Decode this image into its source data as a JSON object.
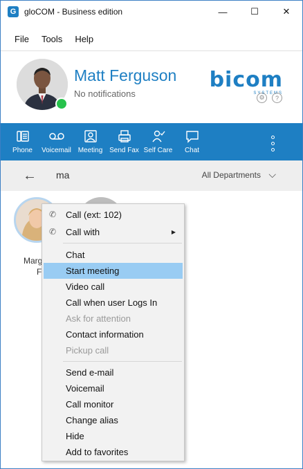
{
  "window": {
    "title": "gloCOM - Business edition",
    "app_icon": "G",
    "controls": {
      "minimize": "—",
      "maximize": "☐",
      "close": "✕"
    }
  },
  "menubar": {
    "items": [
      "File",
      "Tools",
      "Help"
    ]
  },
  "profile": {
    "name": "Matt Ferguson",
    "status_text": "No notifications",
    "presence_color": "#27c24c",
    "brand": "bicom",
    "brand_sub": "SYSTEMS",
    "settings_icon": "gear-icon",
    "help_icon": "?"
  },
  "toolbar": {
    "buttons": [
      {
        "label": "Phone",
        "icon": "phone-icon"
      },
      {
        "label": "Voicemail",
        "icon": "voicemail-icon"
      },
      {
        "label": "Meeting",
        "icon": "meeting-icon"
      },
      {
        "label": "Send Fax",
        "icon": "fax-icon"
      },
      {
        "label": "Self Care",
        "icon": "self-care-icon"
      },
      {
        "label": "Chat",
        "icon": "chat-icon"
      }
    ],
    "more_icon": "kebab-icon"
  },
  "search": {
    "value": "ma",
    "department": "All Departments"
  },
  "contacts": {
    "name_line1": "Marg",
    "name_line2": "Fe"
  },
  "context_menu": {
    "items": [
      {
        "label": "Call (ext: 102)",
        "phone_icon": true
      },
      {
        "label": "Call with",
        "phone_icon": true,
        "submenu": true
      },
      {
        "label": "Chat"
      },
      {
        "label": "Start meeting",
        "selected": true
      },
      {
        "label": "Video call"
      },
      {
        "label": "Call when user Logs In"
      },
      {
        "label": "Ask for attention",
        "disabled": true
      },
      {
        "label": "Contact information"
      },
      {
        "label": "Pickup call",
        "disabled": true
      },
      {
        "label": "Send e-mail"
      },
      {
        "label": "Voicemail"
      },
      {
        "label": "Call monitor"
      },
      {
        "label": "Change alias"
      },
      {
        "label": "Hide"
      },
      {
        "label": "Add to favorites"
      }
    ]
  },
  "colors": {
    "accent": "#1e7fc3",
    "menu_highlight": "#99ccf3",
    "disabled_text": "#9a9a9a"
  }
}
